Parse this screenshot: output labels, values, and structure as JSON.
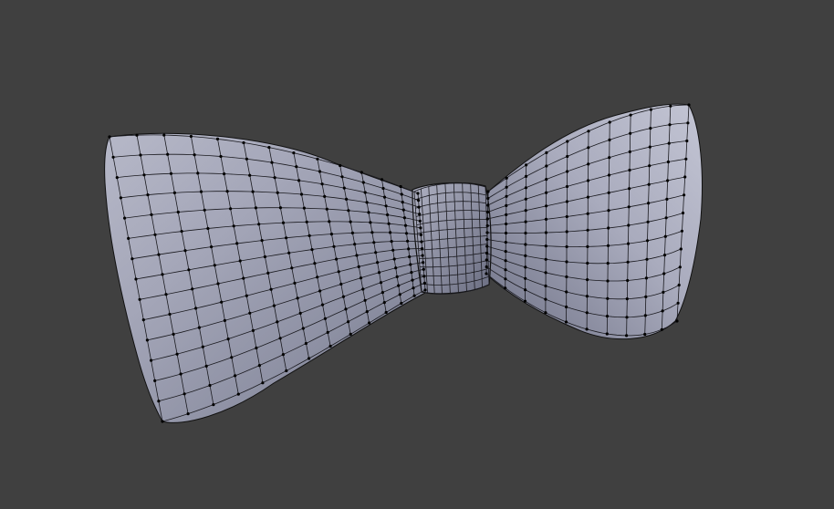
{
  "viewport": {
    "background": "#404040",
    "object": "bow-tie",
    "display_mode": "wireframe-on-shaded",
    "colors": {
      "mesh_light": "#cdd0de",
      "mesh_mid": "#9a9db0",
      "mesh_dark": "#55586a",
      "wire": "#111111",
      "vertex": "#000000"
    }
  }
}
